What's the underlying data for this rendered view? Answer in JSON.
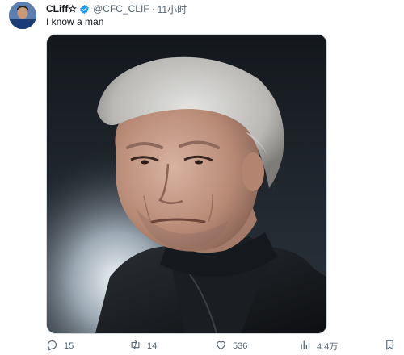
{
  "author": {
    "name": "CLiff☆",
    "handle": "@CFC_CLIF",
    "separator": "·",
    "time": "11小时"
  },
  "tweet": {
    "text": "I know a man"
  },
  "actions": {
    "reply_count": "15",
    "retweet_count": "14",
    "like_count": "536",
    "view_count": "4.4万"
  },
  "icons": {
    "verified": "verified-badge-icon",
    "reply": "reply-icon",
    "retweet": "retweet-icon",
    "like": "like-icon",
    "views": "views-icon",
    "bookmark": "bookmark-icon"
  },
  "colors": {
    "text": "#0f1419",
    "secondary": "#536471",
    "verified": "#1d9bf0"
  }
}
